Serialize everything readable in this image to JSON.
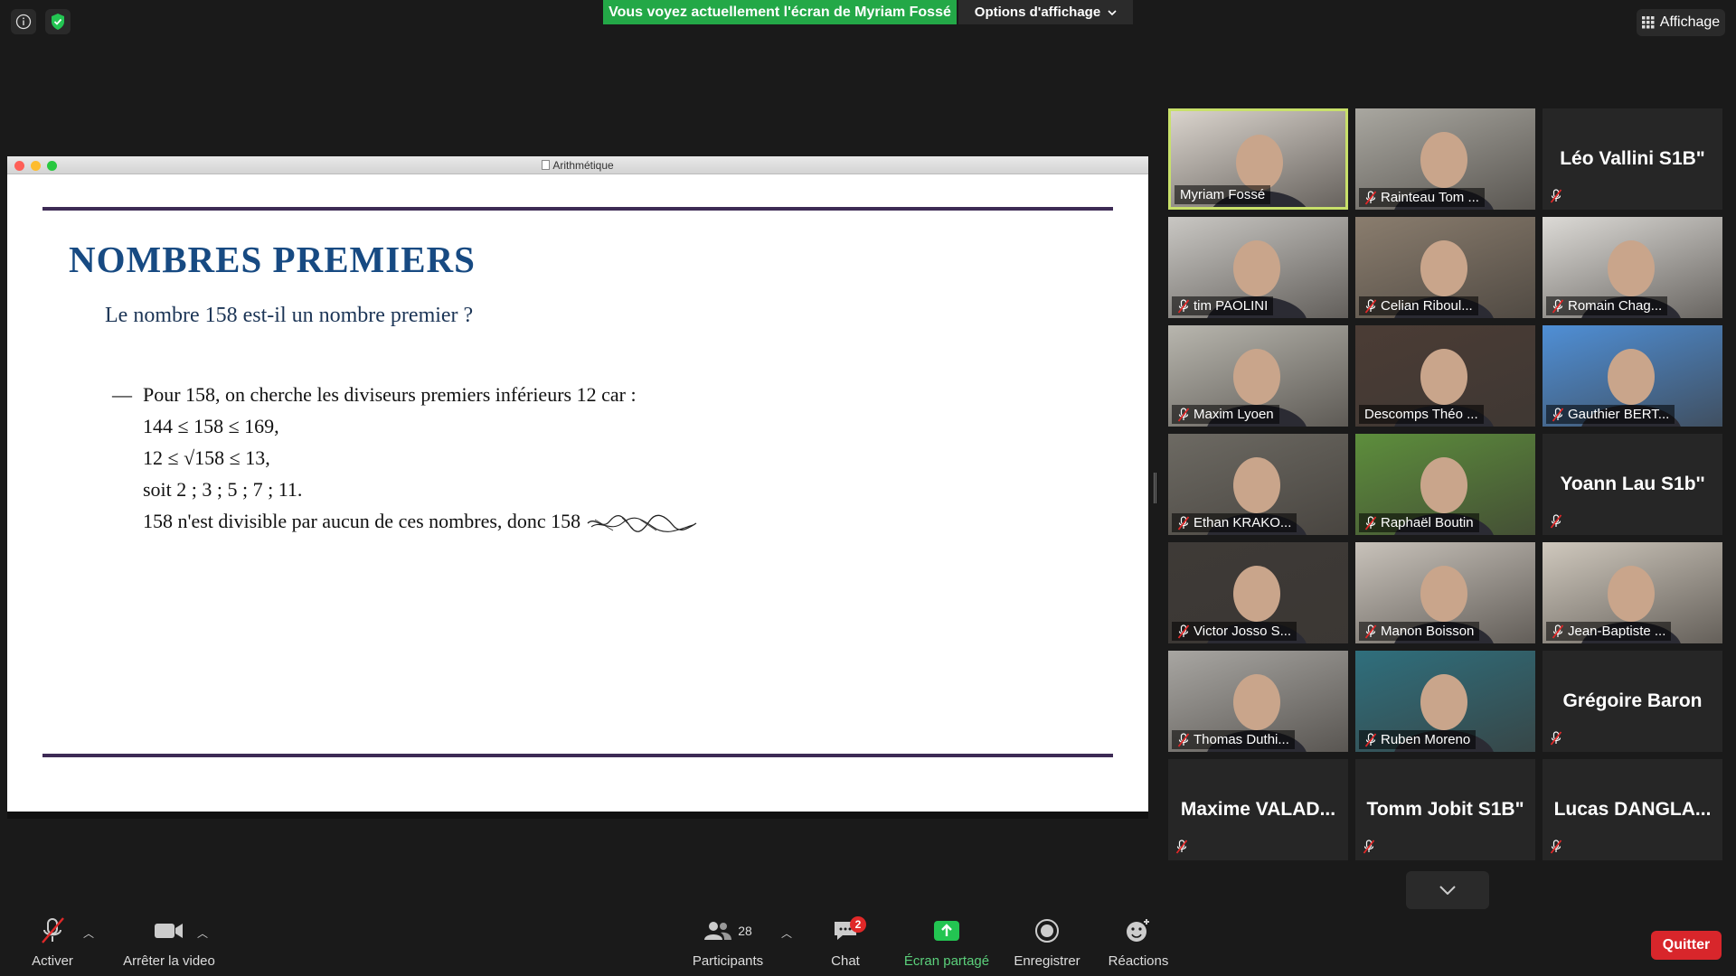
{
  "top": {
    "share_banner": "Vous voyez actuellement l'écran de Myriam Fossé",
    "view_options": "Options d'affichage",
    "view_button": "Affichage"
  },
  "shared_window": {
    "title": "Arithmétique",
    "slide": {
      "title": "NOMBRES PREMIERS",
      "question": "Le nombre 158 est-il un nombre premier ?",
      "lines": [
        "Pour 158, on cherche les diviseurs premiers inférieurs 12 car :",
        "144 ≤ 158 ≤ 169,",
        "12 ≤ √158 ≤ 13,",
        "soit 2 ; 3 ; 5 ; 7 ; 11.",
        "158 n'est divisible par aucun de ces nombres, donc 158"
      ],
      "bullet": "—"
    }
  },
  "participants": [
    {
      "name": "Myriam Fossé",
      "video": true,
      "muted": false,
      "active": true,
      "bg": "#d9d3cc"
    },
    {
      "name": "Rainteau Tom ...",
      "video": true,
      "muted": true,
      "bg": "#a9a7a0"
    },
    {
      "name": "Léo Vallini S1B\"",
      "video": false,
      "muted": true
    },
    {
      "name": "tim PAOLINI",
      "video": true,
      "muted": true,
      "bg": "#c9c7c3"
    },
    {
      "name": "Celian Riboul...",
      "video": true,
      "muted": true,
      "bg": "#8a7d6e"
    },
    {
      "name": "Romain Chag...",
      "video": true,
      "muted": true,
      "bg": "#dcdad6"
    },
    {
      "name": "Maxim Lyoen",
      "video": true,
      "muted": true,
      "bg": "#b8b6ae"
    },
    {
      "name": "Descomps Théo ...",
      "video": true,
      "muted": false,
      "bg": "#4b3c35"
    },
    {
      "name": "Gauthier BERT...",
      "video": true,
      "muted": true,
      "bg": "#4f8fd6"
    },
    {
      "name": "Ethan KRAKO...",
      "video": true,
      "muted": true,
      "bg": "#6d6a63"
    },
    {
      "name": "Raphaël Boutin",
      "video": true,
      "muted": true,
      "bg": "#5d8e3c"
    },
    {
      "name": "Yoann Lau S1b''",
      "video": false,
      "muted": true
    },
    {
      "name": "Victor Josso S...",
      "video": true,
      "muted": true,
      "bg": "#3e3a37"
    },
    {
      "name": "Manon Boisson",
      "video": true,
      "muted": true,
      "bg": "#c8c2ba"
    },
    {
      "name": "Jean-Baptiste ...",
      "video": true,
      "muted": true,
      "bg": "#cfc8bd"
    },
    {
      "name": "Thomas Duthi...",
      "video": true,
      "muted": true,
      "bg": "#a8a6a2"
    },
    {
      "name": "Ruben Moreno",
      "video": true,
      "muted": true,
      "bg": "#2f6f7d"
    },
    {
      "name": "Grégoire Baron",
      "video": false,
      "muted": true
    },
    {
      "name": "Maxime  VALAD...",
      "video": false,
      "muted": true
    },
    {
      "name": "Tomm Jobit S1B\"",
      "video": false,
      "muted": true
    },
    {
      "name": "Lucas  DANGLA...",
      "video": false,
      "muted": true
    }
  ],
  "toolbar": {
    "unmute": "Activer",
    "stop_video": "Arrêter la video",
    "participants": "Participants",
    "participants_count": "28",
    "chat": "Chat",
    "chat_badge": "2",
    "share": "Écran partagé",
    "record": "Enregistrer",
    "reactions": "Réactions",
    "quit": "Quitter"
  },
  "colors": {
    "share_green": "#23a847",
    "active_speaker": "#c8e06a",
    "quit_red": "#d8262b",
    "slide_title": "#174a82",
    "rule": "#3d2b55"
  }
}
